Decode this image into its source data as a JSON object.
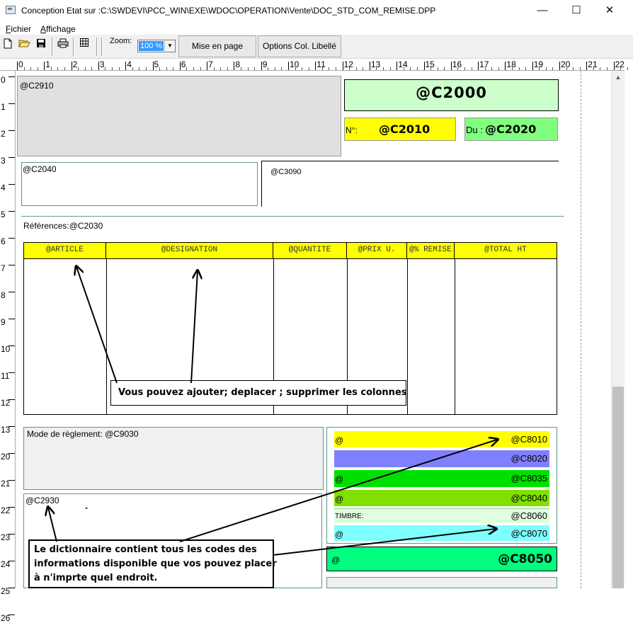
{
  "window": {
    "title": "Conception Etat sur :C:\\SWDEVI\\PCC_WIN\\EXE\\WDOC\\OPERATION\\Vente\\DOC_STD_COM_REMISE.DPP",
    "minimize": "—",
    "maximize": "☐",
    "close": "✕"
  },
  "menu": {
    "fichier": "Fichier",
    "affichage": "Affichage"
  },
  "toolbar": {
    "zoom_label": "Zoom:",
    "zoom_value": "100 %",
    "mise_en_page": "Mise en page",
    "options_col": "Options Col. Libellé"
  },
  "ruler": {
    "top": [
      "0",
      "1",
      "2",
      "3",
      "4",
      "5",
      "6",
      "7",
      "8",
      "9",
      "10",
      "11",
      "12",
      "13",
      "14",
      "15",
      "16",
      "17",
      "18",
      "19",
      "20",
      "21",
      "22"
    ],
    "left": [
      "0",
      "1",
      "2",
      "3",
      "4",
      "5",
      "6",
      "7",
      "8",
      "9",
      "10",
      "11",
      "12",
      "13",
      "20",
      "21",
      "22",
      "23",
      "24",
      "25",
      "26"
    ]
  },
  "report": {
    "c2910": "@C2910",
    "c2000": "@C2000",
    "no_label": "N°:",
    "c2010": "@C2010",
    "du_label": "Du :",
    "c2020": "@C2020",
    "c2040": "@C2040",
    "c3090": "@C3090",
    "references": "Références:@C2030",
    "columns": [
      "@ARTICLE",
      "@DESIGNATION",
      "@QUANTITE",
      "@PRIX U.",
      "@% REMISE",
      "@TOTAL HT"
    ],
    "mode_reglement": "Mode de règlement:  @C9030",
    "c2930": "@C2930",
    "dash_mark": "-",
    "totals": [
      {
        "left": "@",
        "right": "@C8010",
        "color": "#ffff00"
      },
      {
        "left": "",
        "right": "@C8020",
        "color": "#8080ff"
      },
      {
        "left": "@",
        "right": "@C8035",
        "color": "#00e000"
      },
      {
        "left": "@",
        "right": "@C8040",
        "color": "#80e000"
      },
      {
        "left": "TIMBRE:",
        "right": "@C8060",
        "color": "#e0ffe0"
      },
      {
        "left": "@",
        "right": "@C8070",
        "color": "#80ffff"
      }
    ],
    "c8050_left": "@",
    "c8050": "@C8050"
  },
  "callouts": {
    "columns": "Vous pouvez ajouter; deplacer ; supprimer les colonnes",
    "dictionary_1": "Le dictionnaire contient tous les codes des",
    "dictionary_2": "informations disponible que vos pouvez placer",
    "dictionary_3": "à n'imprte quel endroit."
  },
  "colors": {
    "yellow": "#ffff00",
    "green_header": "#ccffcc",
    "green_du": "#80ff80",
    "green_total": "#00ff80",
    "gray_box": "#e0e0e0"
  }
}
